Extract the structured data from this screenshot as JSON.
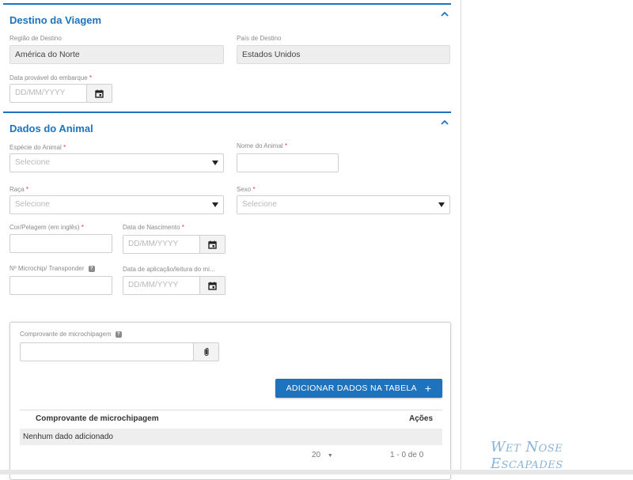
{
  "sections": {
    "destino": {
      "title": "Destino da Viagem",
      "regiao": {
        "label": "Região de Destino",
        "value": "América do Norte"
      },
      "pais": {
        "label": "País de Destino",
        "value": "Estados Unidos"
      },
      "data_embarque": {
        "label": "Data provável do embarque",
        "required_mark": "*",
        "placeholder": "DD/MM/YYYY"
      }
    },
    "animal": {
      "title": "Dados do Animal",
      "especie": {
        "label": "Espécie do Animal",
        "required_mark": "*",
        "placeholder": "Selecione"
      },
      "nome": {
        "label": "Nome do Animal",
        "required_mark": "*",
        "value": ""
      },
      "raca": {
        "label": "Raça",
        "required_mark": "*",
        "placeholder": "Selecione"
      },
      "sexo": {
        "label": "Sexo",
        "required_mark": "*",
        "placeholder": "Selecione"
      },
      "cor": {
        "label": "Cor/Pelagem (em inglês)",
        "required_mark": "*",
        "value": ""
      },
      "nascimento": {
        "label": "Data de Nascimento",
        "required_mark": "*",
        "placeholder": "DD/MM/YYYY"
      },
      "microchip": {
        "label": "Nº Microchip/ Transponder",
        "value": ""
      },
      "aplicacao": {
        "label": "Data de aplicação/leitura do mi...",
        "placeholder": "DD/MM/YYYY"
      }
    },
    "comprovante": {
      "label": "Comprovante de microchipagem",
      "add_button_label": "ADICIONAR DADOS NA TABELA",
      "add_button_icon": "+",
      "table": {
        "columns": [
          "Comprovante de microchipagem",
          "Ações"
        ],
        "empty_text": "Nenhum dado adicionado"
      },
      "pager": {
        "page_size": "20",
        "range": "1 - 0 de 0"
      }
    }
  },
  "watermark": "Wet Nose Escapades",
  "icons": {
    "collapse": "chevron-up-icon",
    "calendar": "calendar-icon",
    "attach": "paperclip-icon",
    "help": "help-icon",
    "dropdown": "caret-down-icon"
  },
  "colors": {
    "accent": "#1e73be",
    "required": "#e23a3a",
    "readonly_bg": "#eeeeee"
  }
}
